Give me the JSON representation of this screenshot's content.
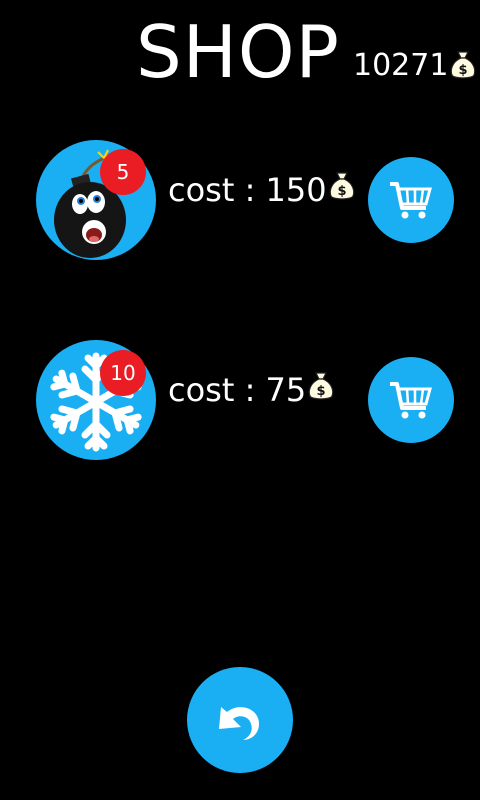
{
  "header": {
    "title": "SHOP",
    "balance": "10271",
    "currency_icon": "money-bag-icon"
  },
  "items": [
    {
      "name": "bomb",
      "icon": "bomb-icon",
      "count": "5",
      "cost_text": "cost : 150",
      "buy_icon": "cart-icon"
    },
    {
      "name": "freeze",
      "icon": "snowflake-icon",
      "count": "10",
      "cost_text": "cost : 75",
      "buy_icon": "cart-icon"
    }
  ],
  "footer": {
    "back_icon": "undo-arrow-icon"
  },
  "colors": {
    "background": "#000000",
    "accent": "#1aaef2",
    "badge": "#ea1c24",
    "text": "#ffffff"
  }
}
